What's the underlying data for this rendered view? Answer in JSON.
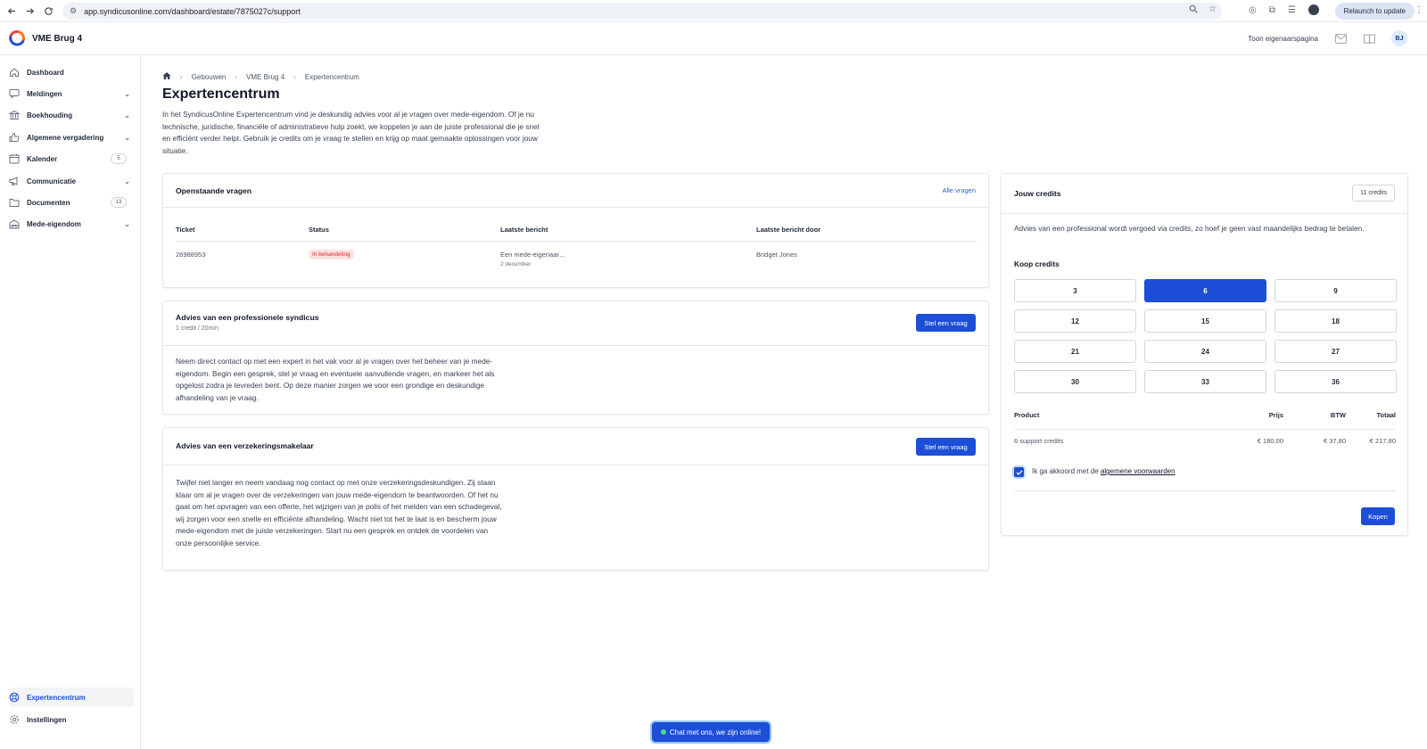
{
  "browser": {
    "url": "app.syndicusonline.com/dashboard/estate/7875027c/support",
    "relaunch_label": "Relaunch to update"
  },
  "app": {
    "title": "VME Brug 4",
    "owner_page_link": "Toon eigenaarspagina",
    "avatar_initials": "BJ"
  },
  "sidebar": {
    "items": [
      {
        "label": "Dashboard"
      },
      {
        "label": "Meldingen"
      },
      {
        "label": "Boekhouding"
      },
      {
        "label": "Algemene vergadering"
      },
      {
        "label": "Kalender",
        "badge": "5"
      },
      {
        "label": "Communicatie"
      },
      {
        "label": "Documenten",
        "badge": "13"
      },
      {
        "label": "Mede-eigendom"
      }
    ],
    "bottom": [
      {
        "label": "Expertencentrum"
      },
      {
        "label": "Instellingen"
      }
    ]
  },
  "breadcrumb": [
    "Gebouwen",
    "VME Brug 4",
    "Expertencentrum"
  ],
  "page": {
    "title": "Expertencentrum",
    "intro": "In het SyndicusOnline Expertencentrum vind je deskundig advies voor al je vragen over mede-eigendom. Of je nu technische, juridische, financiële of administratieve hulp zoekt, we koppelen je aan de juiste professional die je snel en efficiënt verder helpt. Gebruik je credits om je vraag te stellen en krijg op maat gemaakte oplossingen voor jouw situatie."
  },
  "open_questions": {
    "title": "Openstaande vragen",
    "all_link": "Alle vragen",
    "columns": [
      "Ticket",
      "Status",
      "Laatste bericht",
      "Laatste bericht door"
    ],
    "rows": [
      {
        "ticket": "26988953",
        "status": "In behandeling",
        "last_message": "Een mede-eigenaar…",
        "last_date": "2 december",
        "last_by": "Bridget Jones"
      }
    ]
  },
  "advice_syndicus": {
    "title": "Advies van een professionele syndicus",
    "subtitle": "1 credit / 20min",
    "button": "Stel een vraag",
    "body": "Neem direct contact op met een expert in het vak voor al je vragen over het beheer van je mede-eigendom. Begin een gesprek, stel je vraag en eventuele aanvullende vragen, en markeer het als opgelost zodra je tevreden bent. Op deze manier zorgen we voor een grondige en deskundige afhandeling van je vraag."
  },
  "advice_insurance": {
    "title": "Advies van een verzekeringsmakelaar",
    "button": "Stel een vraag",
    "body": "Twijfel niet langer en neem vandaag nog contact op met onze verzekeringsdeskundigen. Zij staan klaar om al je vragen over de verzekeringen van jouw mede-eigendom te beantwoorden. Of het nu gaat om het opvragen van een offerte, het wijzigen van je polis of het melden van een schadegeval, wij zorgen voor een snelle en efficiënte afhandeling. Wacht niet tot het te laat is en bescherm jouw mede-eigendom met de juiste verzekeringen. Start nu een gesprek en ontdek de voordelen van onze persoonlijke service."
  },
  "credits": {
    "title": "Jouw credits",
    "balance": "11 credits",
    "description": "Advies van een professional wordt vergoed via credits, zo hoef je geen vast maandelijks bedrag te betalen.",
    "buy_title": "Koop credits",
    "options": [
      "3",
      "6",
      "9",
      "12",
      "15",
      "18",
      "21",
      "24",
      "27",
      "30",
      "33",
      "36"
    ],
    "selected": "6",
    "table_headers": [
      "Product",
      "Prijs",
      "BTW",
      "Totaal"
    ],
    "row": {
      "product": "6 support credits",
      "price": "€ 180,00",
      "vat": "€ 37,80",
      "total": "€ 217,80"
    },
    "agree_prefix": "Ik ga akkoord met de",
    "agree_link": "algemene voorwaarden",
    "agree_checked": true,
    "buy_button": "Kopen"
  },
  "chat": {
    "label": "Chat met ons, we zijn online!"
  },
  "colors": {
    "primary": "#1d4ed8",
    "danger": "#dc2626",
    "danger_bg": "#fee2e2"
  }
}
